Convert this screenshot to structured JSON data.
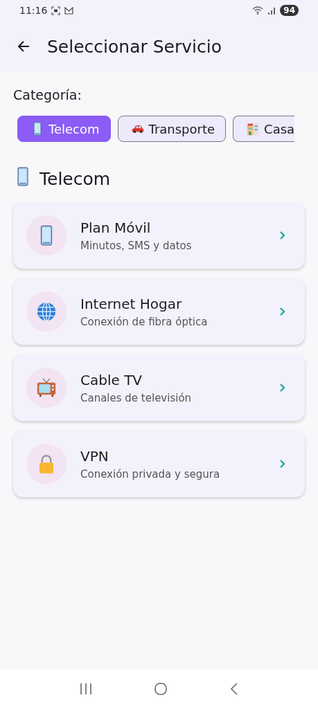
{
  "status_bar": {
    "time": "11:16",
    "battery": "94"
  },
  "header": {
    "title": "Seleccionar Servicio"
  },
  "category_label": "Categoría:",
  "categories": [
    {
      "label": "Telecom",
      "kind": "phone",
      "selected": true
    },
    {
      "label": "Transporte",
      "kind": "car",
      "selected": false
    },
    {
      "label": "Casa",
      "kind": "building",
      "selected": false
    }
  ],
  "section": {
    "title": "Telecom",
    "kind": "phone"
  },
  "services": [
    {
      "title": "Plan Móvil",
      "subtitle": "Minutos, SMS y datos",
      "kind": "phone"
    },
    {
      "title": "Internet Hogar",
      "subtitle": "Conexión de fibra óptica",
      "kind": "globe"
    },
    {
      "title": "Cable TV",
      "subtitle": "Canales de televisión",
      "kind": "tv"
    },
    {
      "title": "VPN",
      "subtitle": "Conexión privada y segura",
      "kind": "lock"
    }
  ]
}
